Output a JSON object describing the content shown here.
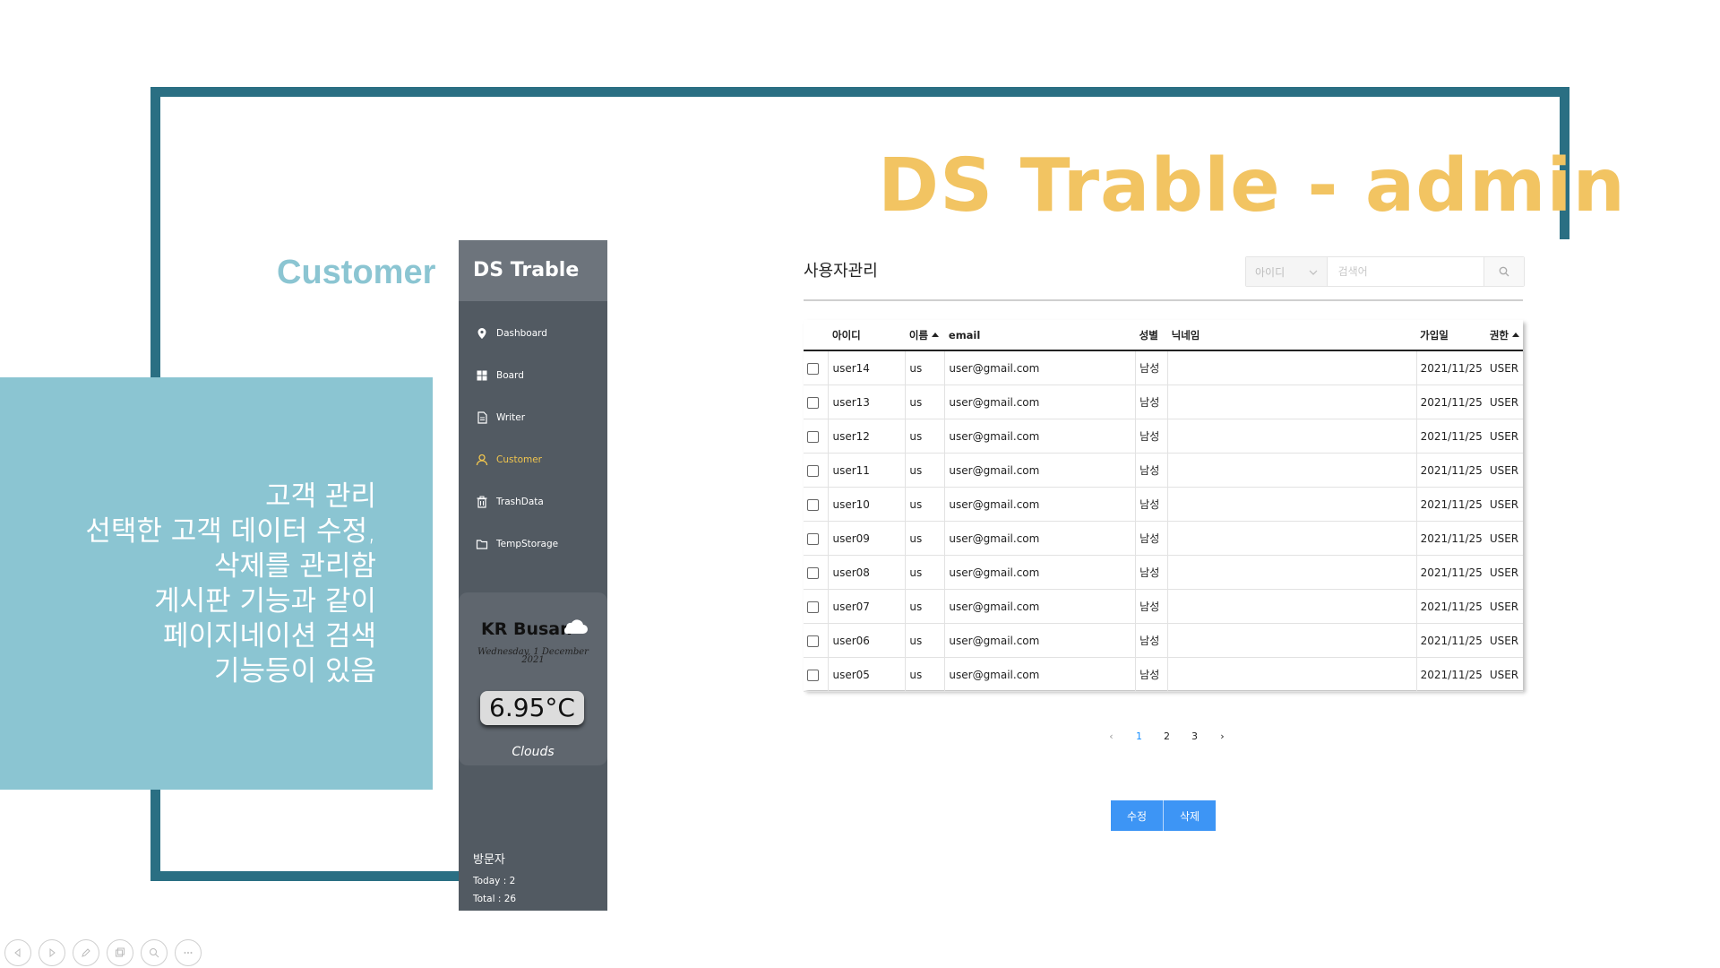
{
  "slide": {
    "title": "DS Trable - admin",
    "subtitle": "Customer",
    "description": [
      "고객 관리",
      "선택한 고객 데이터 수정,",
      "삭제를 관리함",
      "게시판 기능과 같이",
      "페이지네이션 검색",
      "기능등이 있음"
    ],
    "colors": {
      "frame": "#2a6f83",
      "title": "#f2c462",
      "accent": "#8bc5d2"
    }
  },
  "sidebar": {
    "brand": "DS Trable",
    "items": [
      {
        "label": "Dashboard",
        "icon": "location-pin-icon",
        "active": false
      },
      {
        "label": "Board",
        "icon": "grid-icon",
        "active": false
      },
      {
        "label": "Writer",
        "icon": "document-icon",
        "active": false
      },
      {
        "label": "Customer",
        "icon": "user-icon",
        "active": true
      },
      {
        "label": "TrashData",
        "icon": "trash-icon",
        "active": false
      },
      {
        "label": "TempStorage",
        "icon": "folder-icon",
        "active": false
      }
    ],
    "weather": {
      "location": "KR Busan",
      "date": "Wednesday, 1 December 2021",
      "temperature": "6.95°C",
      "condition": "Clouds"
    },
    "visitors": {
      "title": "방문자",
      "today": "Today : 2",
      "total": "Total : 26"
    }
  },
  "main": {
    "title": "사용자관리",
    "search": {
      "select_value": "아이디",
      "placeholder": "검색어"
    },
    "table": {
      "headers": [
        "아이디",
        "이름",
        "email",
        "성별",
        "닉네임",
        "가입일",
        "권한"
      ],
      "rows": [
        {
          "id": "user14",
          "name": "us",
          "email": "user@gmail.com",
          "gender": "남성",
          "nickname": "",
          "joined": "2021/11/25",
          "role": "USER"
        },
        {
          "id": "user13",
          "name": "us",
          "email": "user@gmail.com",
          "gender": "남성",
          "nickname": "",
          "joined": "2021/11/25",
          "role": "USER"
        },
        {
          "id": "user12",
          "name": "us",
          "email": "user@gmail.com",
          "gender": "남성",
          "nickname": "",
          "joined": "2021/11/25",
          "role": "USER"
        },
        {
          "id": "user11",
          "name": "us",
          "email": "user@gmail.com",
          "gender": "남성",
          "nickname": "",
          "joined": "2021/11/25",
          "role": "USER"
        },
        {
          "id": "user10",
          "name": "us",
          "email": "user@gmail.com",
          "gender": "남성",
          "nickname": "",
          "joined": "2021/11/25",
          "role": "USER"
        },
        {
          "id": "user09",
          "name": "us",
          "email": "user@gmail.com",
          "gender": "남성",
          "nickname": "",
          "joined": "2021/11/25",
          "role": "USER"
        },
        {
          "id": "user08",
          "name": "us",
          "email": "user@gmail.com",
          "gender": "남성",
          "nickname": "",
          "joined": "2021/11/25",
          "role": "USER"
        },
        {
          "id": "user07",
          "name": "us",
          "email": "user@gmail.com",
          "gender": "남성",
          "nickname": "",
          "joined": "2021/11/25",
          "role": "USER"
        },
        {
          "id": "user06",
          "name": "us",
          "email": "user@gmail.com",
          "gender": "남성",
          "nickname": "",
          "joined": "2021/11/25",
          "role": "USER"
        },
        {
          "id": "user05",
          "name": "us",
          "email": "user@gmail.com",
          "gender": "남성",
          "nickname": "",
          "joined": "2021/11/25",
          "role": "USER"
        }
      ]
    },
    "pagination": {
      "prev": "‹",
      "pages": [
        "1",
        "2",
        "3"
      ],
      "active_page": "1",
      "next": "›"
    },
    "buttons": {
      "edit": "수정",
      "delete": "삭제"
    },
    "colors": {
      "primary_button": "#3d95f5",
      "active_nav": "#f0c54e",
      "sidebar_bg": "#525a62"
    }
  }
}
